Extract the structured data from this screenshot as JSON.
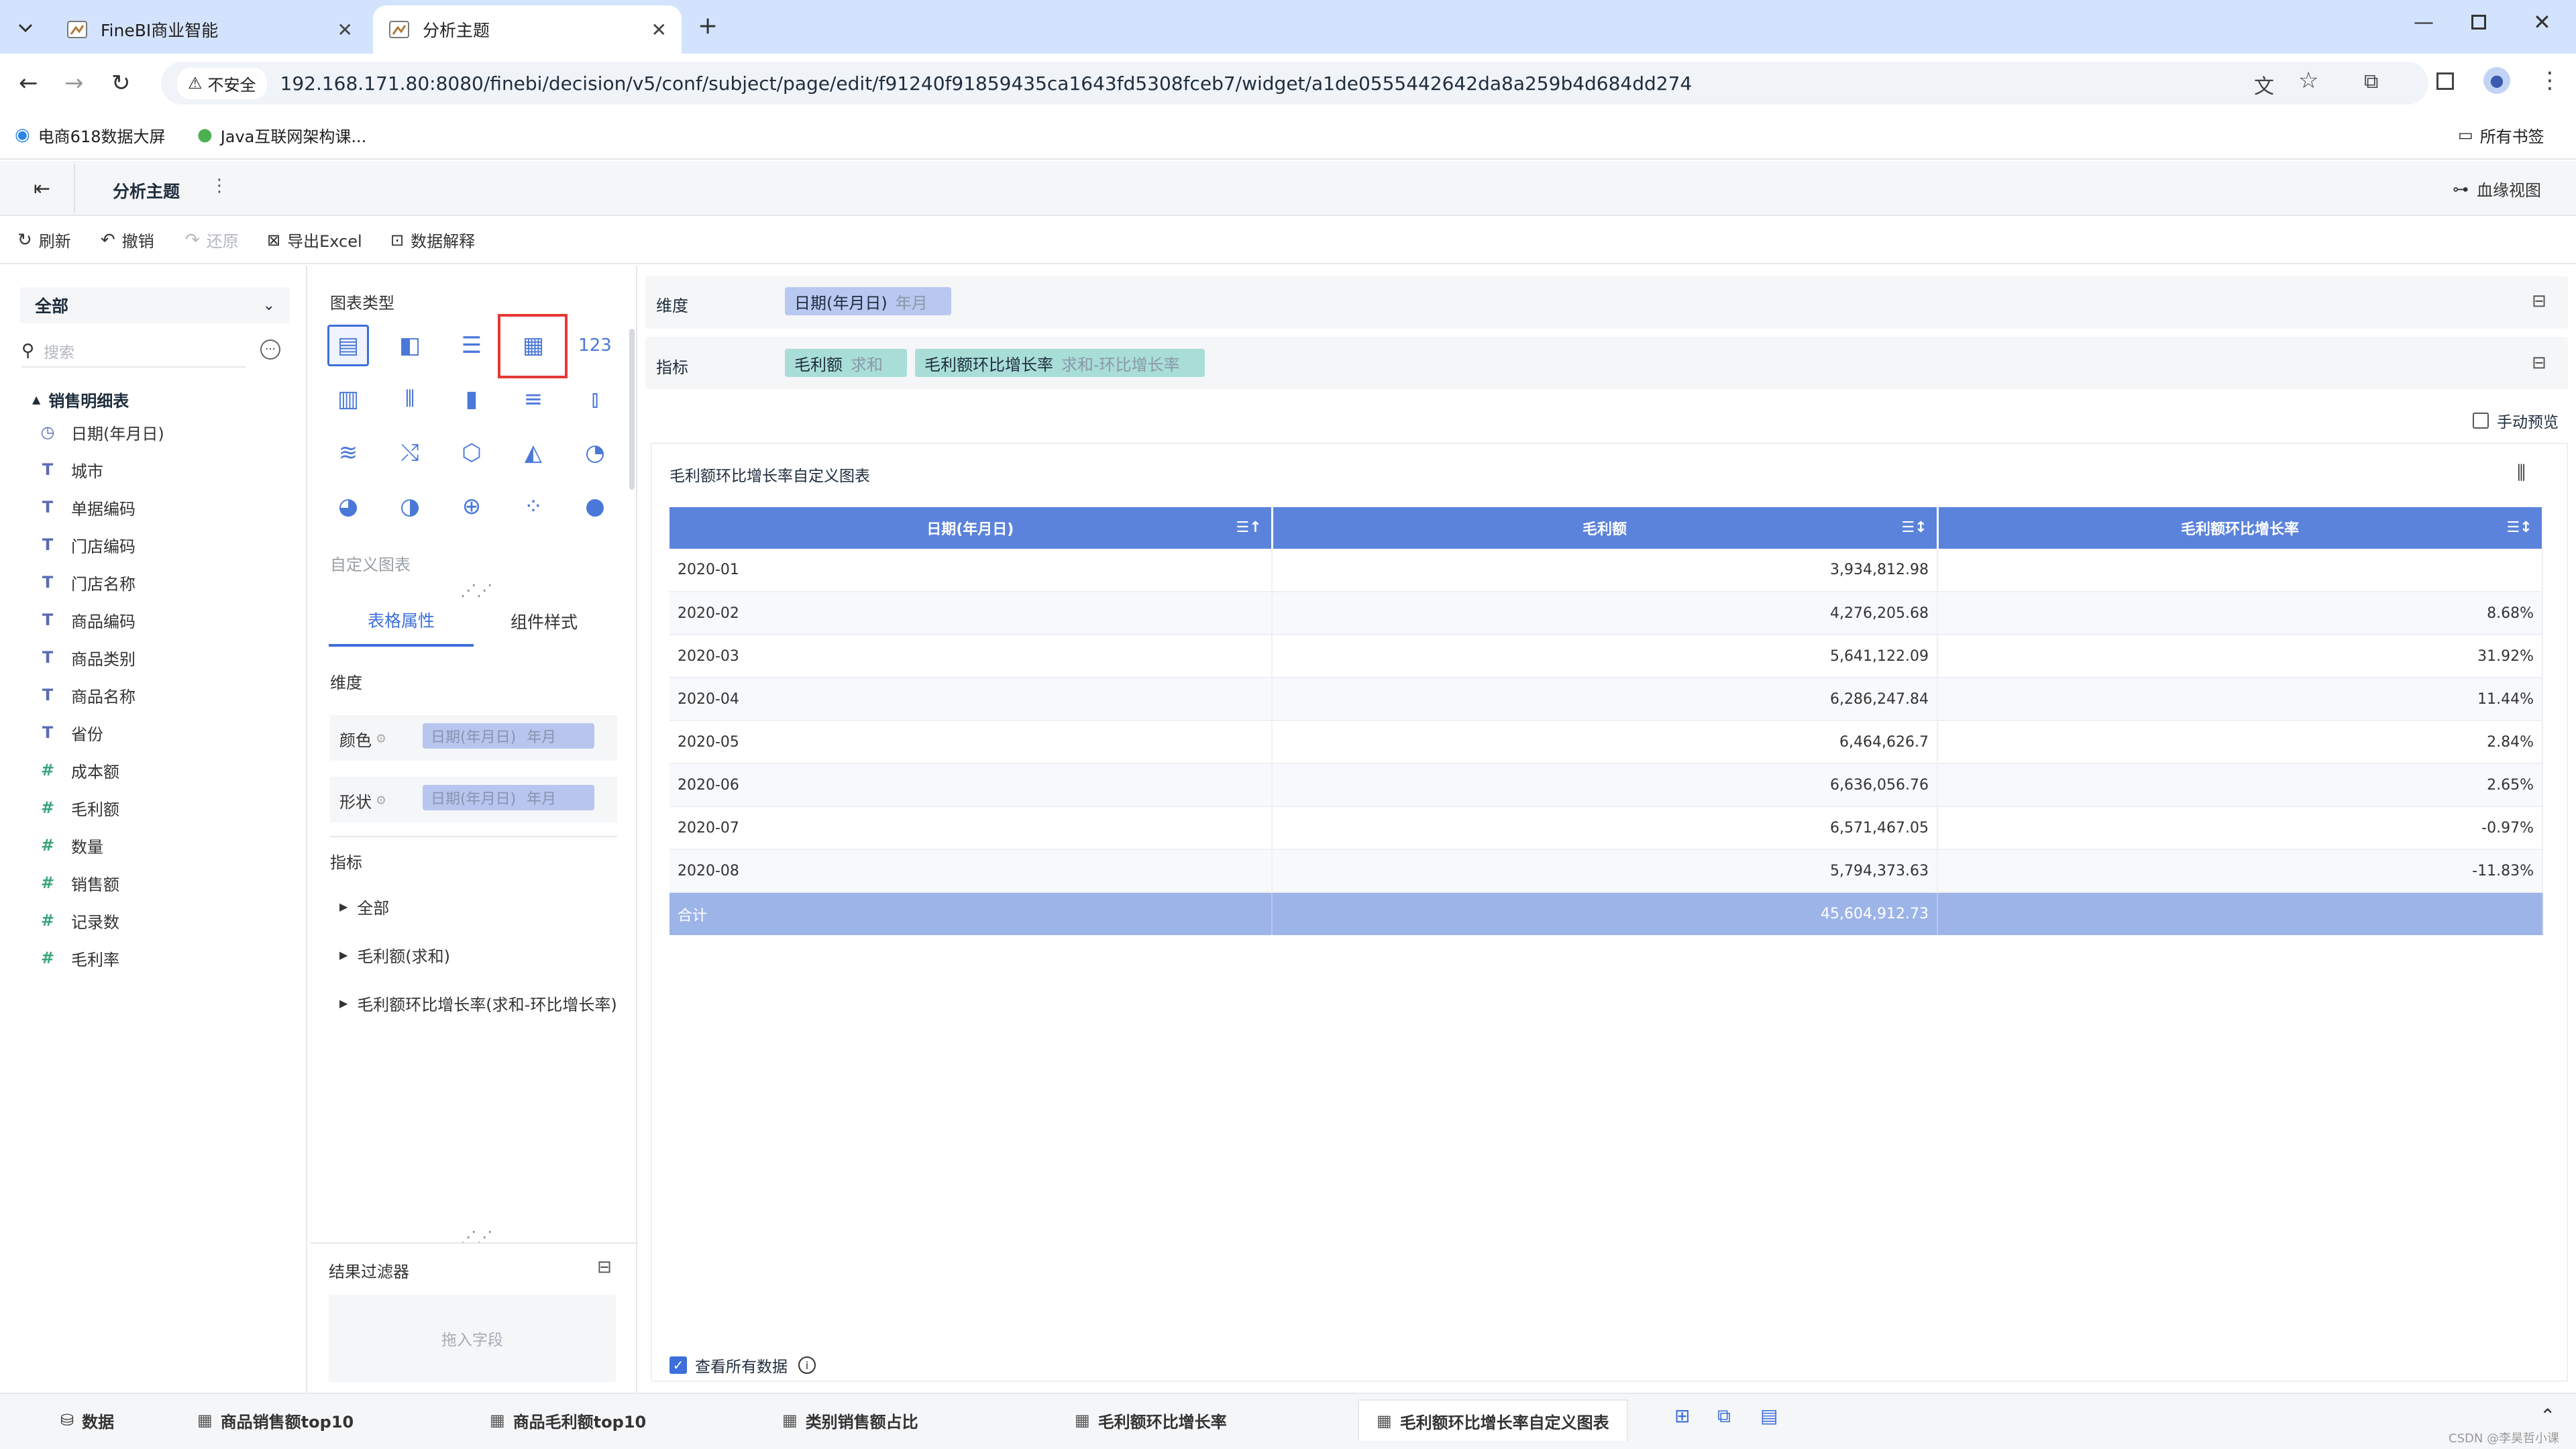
{
  "browser": {
    "tabs": [
      {
        "title": "FineBI商业智能",
        "active": false
      },
      {
        "title": "分析主题",
        "active": true
      }
    ],
    "security_label": "不安全",
    "url": "192.168.171.80:8080/finebi/decision/v5/conf/subject/page/edit/f91240f91859435ca1643fd5308fceb7/widget/a1de0555442642da8a259b4d684dd274",
    "bookmarks": [
      "电商618数据大屏",
      "Java互联网架构课..."
    ],
    "all_bookmarks": "所有书签"
  },
  "header": {
    "title": "分析主题",
    "lineage": "血缘视图"
  },
  "toolbar": {
    "refresh": "刷新",
    "undo": "撤销",
    "redo": "还原",
    "export": "导出Excel",
    "explain": "数据解释"
  },
  "left_pane": {
    "scope": "全部",
    "search_placeholder": "搜索",
    "table_name": "销售明细表",
    "fields": [
      {
        "type": "date",
        "icon": "◷",
        "name": "日期(年月日)"
      },
      {
        "type": "text",
        "icon": "T",
        "name": "城市"
      },
      {
        "type": "text",
        "icon": "T",
        "name": "单据编码"
      },
      {
        "type": "text",
        "icon": "T",
        "name": "门店编码"
      },
      {
        "type": "text",
        "icon": "T",
        "name": "门店名称"
      },
      {
        "type": "text",
        "icon": "T",
        "name": "商品编码"
      },
      {
        "type": "text",
        "icon": "T",
        "name": "商品类别"
      },
      {
        "type": "text",
        "icon": "T",
        "name": "商品名称"
      },
      {
        "type": "text",
        "icon": "T",
        "name": "省份"
      },
      {
        "type": "num",
        "icon": "#",
        "name": "成本额"
      },
      {
        "type": "num",
        "icon": "#",
        "name": "毛利额"
      },
      {
        "type": "num",
        "icon": "#",
        "name": "数量"
      },
      {
        "type": "num",
        "icon": "#",
        "name": "销售额"
      },
      {
        "type": "num",
        "icon": "#",
        "name": "记录数"
      },
      {
        "type": "num",
        "icon": "#",
        "name": "毛利率"
      }
    ]
  },
  "config": {
    "chart_type_label": "图表类型",
    "custom_chart_label": "自定义图表",
    "tab_table_props": "表格属性",
    "tab_component_style": "组件样式",
    "dimension_label": "维度",
    "color_label": "颜色",
    "shape_label": "形状",
    "dim_pill_field": "日期(年月日)",
    "dim_pill_unit": "年月",
    "metric_label": "指标",
    "metric_items": [
      "全部",
      "毛利额(求和)",
      "毛利额环比增长率(求和-环比增长率)"
    ],
    "result_filter": "结果过滤器",
    "drop_field": "拖入字段"
  },
  "drop_rows": {
    "dimension_label": "维度",
    "dimension_field": "日期(年月日)",
    "dimension_sub": "年月",
    "metric_label": "指标",
    "metric1_field": "毛利额",
    "metric1_sub": "求和",
    "metric2_field": "毛利额环比增长率",
    "metric2_sub": "求和-环比增长率",
    "manual_preview": "手动预览"
  },
  "chart_title": "毛利额环比增长率自定义图表",
  "table": {
    "headers": [
      "日期(年月日)",
      "毛利额",
      "毛利额环比增长率"
    ],
    "rows": [
      [
        "2020-01",
        "3,934,812.98",
        ""
      ],
      [
        "2020-02",
        "4,276,205.68",
        "8.68%"
      ],
      [
        "2020-03",
        "5,641,122.09",
        "31.92%"
      ],
      [
        "2020-04",
        "6,286,247.84",
        "11.44%"
      ],
      [
        "2020-05",
        "6,464,626.7",
        "2.84%"
      ],
      [
        "2020-06",
        "6,636,056.76",
        "2.65%"
      ],
      [
        "2020-07",
        "6,571,467.05",
        "-0.97%"
      ],
      [
        "2020-08",
        "5,794,373.63",
        "-11.83%"
      ]
    ],
    "total_label": "合计",
    "total_value": "45,604,912.73"
  },
  "view_all_data": "查看所有数据",
  "bottom_tabs": [
    "数据",
    "商品销售额top10",
    "商品毛利额top10",
    "类别销售额占比",
    "毛利额环比增长率",
    "毛利额环比增长率自定义图表"
  ],
  "watermark": "CSDN @李昊哲小课",
  "colors": {
    "accent": "#3d6fdb",
    "header_blue": "#5b83dc",
    "total_row": "#9db4e8",
    "metric_tag": "#a9ddd8",
    "dim_tag": "#b9c8f0",
    "browser_bar": "#d3e3fd"
  }
}
